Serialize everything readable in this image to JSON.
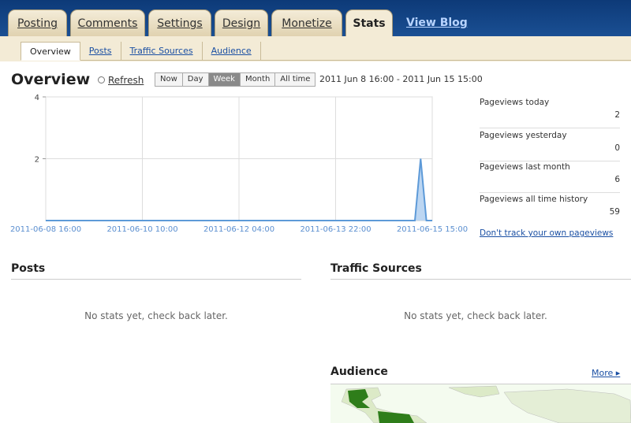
{
  "tabs": [
    {
      "label": "Posting",
      "active": false
    },
    {
      "label": "Comments",
      "active": false
    },
    {
      "label": "Settings",
      "active": false
    },
    {
      "label": "Design",
      "active": false
    },
    {
      "label": "Monetize",
      "active": false
    },
    {
      "label": "Stats",
      "active": true
    }
  ],
  "view_blog": "View Blog",
  "subtabs": [
    {
      "label": "Overview",
      "active": true
    },
    {
      "label": "Posts",
      "active": false
    },
    {
      "label": "Traffic Sources",
      "active": false
    },
    {
      "label": "Audience",
      "active": false
    }
  ],
  "overview": {
    "title": "Overview",
    "refresh": "Refresh",
    "ranges": [
      "Now",
      "Day",
      "Week",
      "Month",
      "All time"
    ],
    "active_range": "Week",
    "date_range": "2011 Jun 8 16:00 - 2011 Jun 15 15:00"
  },
  "chart_data": {
    "type": "line",
    "x_tick_labels": [
      "2011-06-08 16:00",
      "2011-06-10 10:00",
      "2011-06-12 04:00",
      "2011-06-13 22:00",
      "2011-06-15 15:00"
    ],
    "y_tick_labels": [
      "2",
      "4"
    ],
    "ylim": [
      0,
      4
    ],
    "series": [
      {
        "x": [
          0,
          0.9,
          0.955,
          0.97,
          0.985,
          1.0
        ],
        "values": [
          0,
          0,
          0,
          2,
          0,
          0
        ]
      }
    ],
    "colors": {
      "line": "#5d9ad8",
      "fill": "#bcd6f2",
      "grid": "#dddddd"
    }
  },
  "pageviews": [
    {
      "label": "Pageviews today",
      "value": "2"
    },
    {
      "label": "Pageviews yesterday",
      "value": "0"
    },
    {
      "label": "Pageviews last month",
      "value": "6"
    },
    {
      "label": "Pageviews all time history",
      "value": "59"
    }
  ],
  "dont_track": "Don't track your own pageviews",
  "posts": {
    "title": "Posts",
    "empty": "No stats yet, check back later."
  },
  "traffic": {
    "title": "Traffic Sources",
    "empty": "No stats yet, check back later."
  },
  "audience": {
    "title": "Audience",
    "more": "More ▸"
  }
}
